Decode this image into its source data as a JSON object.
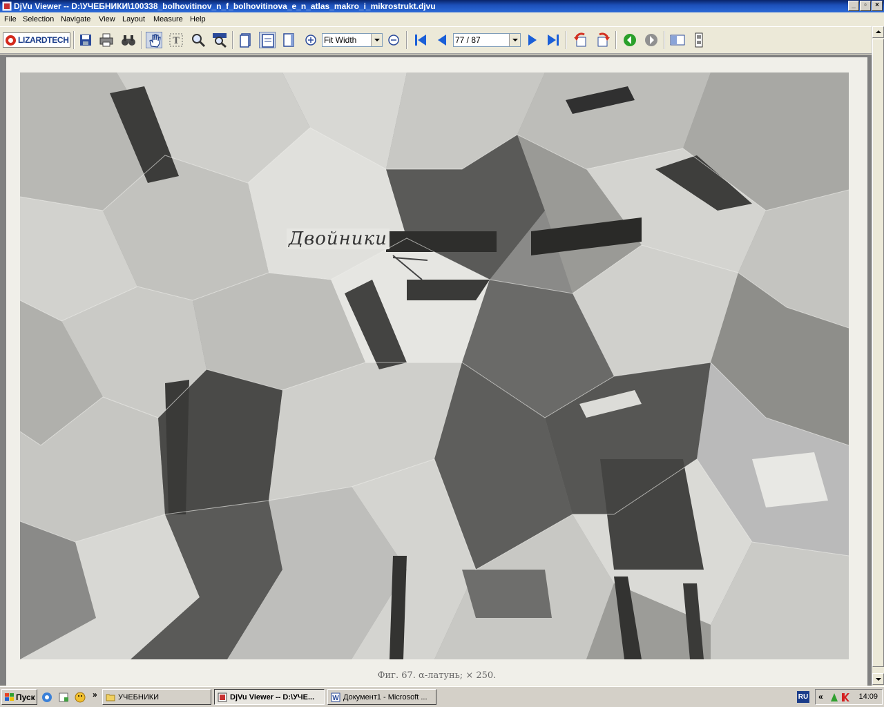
{
  "window": {
    "title": "DjVu Viewer -- D:\\УЧЕБНИКИ\\100338_bolhovitinov_n_f_bolhovitinova_e_n_atlas_makro_i_mikrostrukt.djvu",
    "controls": {
      "minimize": "_",
      "maximize": "▫",
      "close": "×"
    }
  },
  "menu": {
    "items": [
      "File",
      "Selection",
      "Navigate",
      "View",
      "Layout",
      "Measure",
      "Help"
    ]
  },
  "toolbar": {
    "logo_text": "LIZARDTECH",
    "zoom_value": "Fit Width",
    "page_value": "77 / 87",
    "icons": {
      "save": "save-icon",
      "print": "print-icon",
      "find": "binoculars-icon",
      "hand": "hand-icon",
      "text_select": "text-select-icon",
      "zoom": "magnifier-icon",
      "zoom_region": "zoom-region-icon",
      "single_page": "single-page-icon",
      "continuous": "continuous-icon",
      "facing": "facing-icon",
      "zoom_in": "zoom-in-icon",
      "zoom_out": "zoom-out-icon",
      "first": "first-page-icon",
      "prev": "prev-page-icon",
      "next": "next-page-icon",
      "last": "last-page-icon",
      "rotate_left": "rotate-left-icon",
      "rotate_right": "rotate-right-icon",
      "back": "back-icon",
      "forward": "forward-icon",
      "thumbnails": "thumbnails-icon",
      "film": "filmstrip-icon"
    },
    "colors": {
      "accent_blue": "#1a5fd8",
      "rotate_red": "#d43020",
      "nav_green": "#2aa02a"
    }
  },
  "document": {
    "annotation": "Двойники",
    "caption": "Фиг. 67. α-латунь; × 250."
  },
  "taskbar": {
    "start": "Пуск",
    "tasks": [
      {
        "label": "УЧЕБНИКИ",
        "active": false
      },
      {
        "label": "DjVu Viewer -- D:\\УЧЕ...",
        "active": true
      },
      {
        "label": "Документ1 - Microsoft ...",
        "active": false
      }
    ],
    "chevron": "»",
    "tray_chevron": "«",
    "language": "RU",
    "clock": "14:09"
  }
}
